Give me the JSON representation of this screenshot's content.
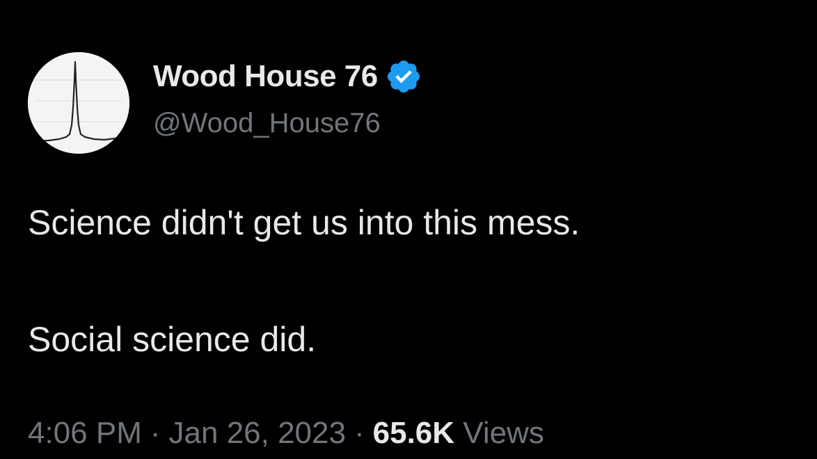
{
  "tweet": {
    "author": {
      "display_name": "Wood House 76",
      "handle": "@Wood_House76",
      "verified_icon": "verified-badge-icon",
      "avatar_icon": "spectrum-peak-avatar"
    },
    "text": {
      "line1": "Science didn't get us into this mess.",
      "line2": "Social science did."
    },
    "meta": {
      "time": "4:06 PM",
      "separator": "·",
      "date": "Jan 26, 2023",
      "views_count": "65.6K",
      "views_label": "Views"
    }
  },
  "colors": {
    "background": "#000000",
    "primary_text": "#e7e9ea",
    "secondary_text": "#71767b",
    "verified_blue": "#1d9bf0"
  }
}
